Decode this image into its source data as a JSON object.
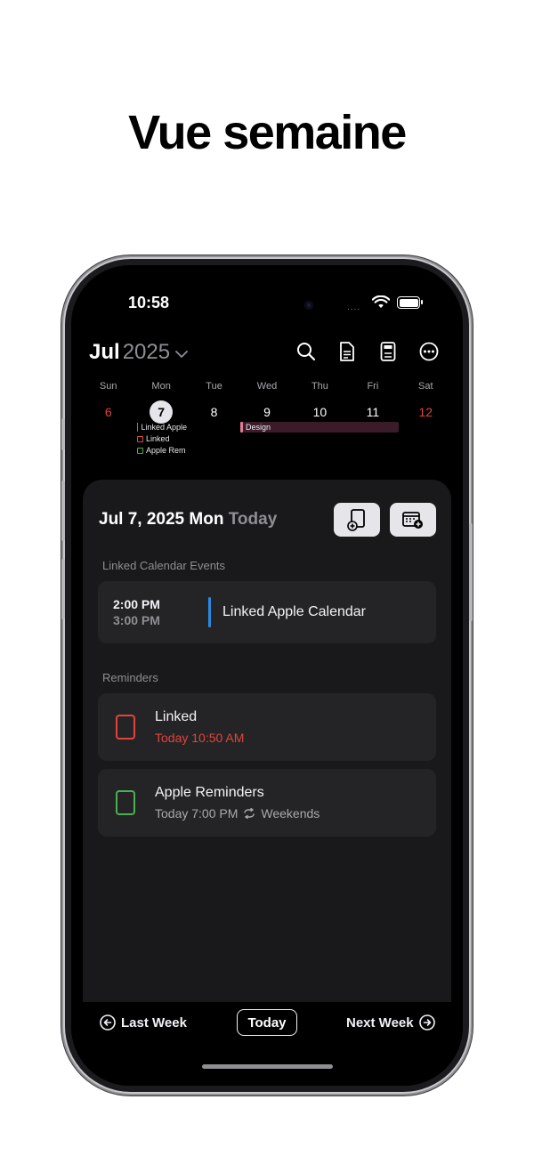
{
  "headline": "Vue semaine",
  "status_bar": {
    "time": "10:58",
    "dots": "...."
  },
  "header": {
    "month": "Jul",
    "year": "2025",
    "chevron": "⌄",
    "toolbar_icons": [
      "search-icon",
      "document-icon",
      "calculator-icon",
      "more-icon"
    ]
  },
  "week": {
    "days": [
      {
        "weekday": "Sun",
        "date": "6",
        "style": "red"
      },
      {
        "weekday": "Mon",
        "date": "7",
        "style": "selected"
      },
      {
        "weekday": "Tue",
        "date": "8",
        "style": "normal"
      },
      {
        "weekday": "Wed",
        "date": "9",
        "style": "normal"
      },
      {
        "weekday": "Thu",
        "date": "10",
        "style": "normal"
      },
      {
        "weekday": "Fri",
        "date": "11",
        "style": "normal"
      },
      {
        "weekday": "Sat",
        "date": "12",
        "style": "red"
      }
    ],
    "monday_items": [
      "Linked Apple",
      "Linked",
      "Apple Rem"
    ],
    "multi_day_event": "Design"
  },
  "sheet": {
    "date": "Jul 7, 2025 Mon",
    "today_label": "Today",
    "linked_section": "Linked Calendar Events",
    "event": {
      "start": "2:00 PM",
      "end": "3:00 PM",
      "title": "Linked Apple Calendar"
    },
    "reminders_section": "Reminders",
    "reminders": [
      {
        "title": "Linked",
        "sub": "Today 10:50 AM",
        "color": "#e2443a"
      },
      {
        "title": "Apple Reminders",
        "sub": "Today 7:00 PM",
        "repeat": "Weekends",
        "color": "#4caf50"
      }
    ]
  },
  "bottom": {
    "last_week": "Last Week",
    "today": "Today",
    "next_week": "Next Week"
  },
  "colors": {
    "accent_red": "#e2443a",
    "event_blue": "#2a8ae4",
    "design_pink": "#e07a97"
  }
}
